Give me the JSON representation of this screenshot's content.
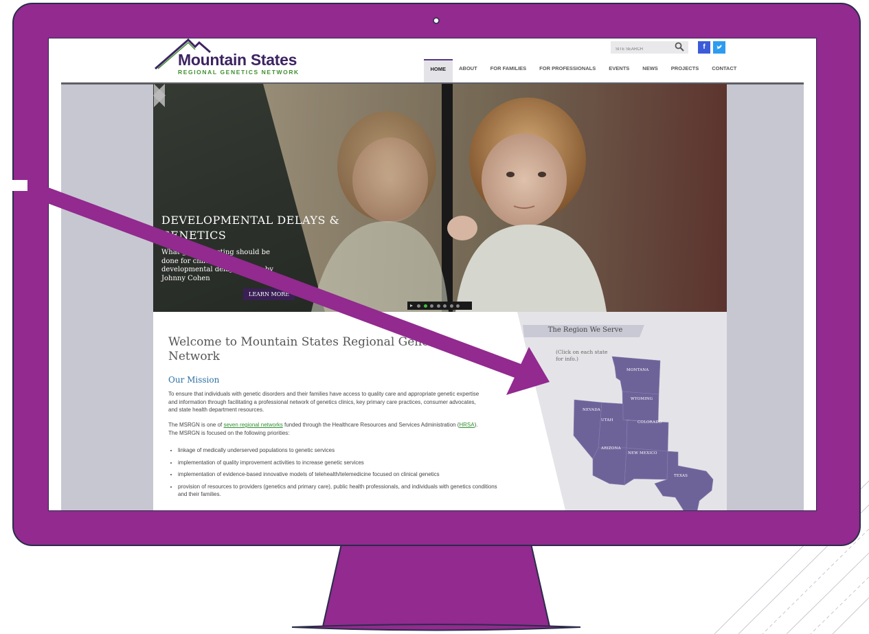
{
  "colors": {
    "monitor": "#922a8f",
    "monitor_outline": "#2b2b4a",
    "brand_purple": "#3d2462",
    "brand_green": "#3f8f2e",
    "state_fill": "#6e6399",
    "mission_blue": "#2a6fa4"
  },
  "logo": {
    "title": "Mountain States",
    "subtitle": "REGIONAL GENETICS NETWORK"
  },
  "search": {
    "placeholder": "SITE SEARCH"
  },
  "social": {
    "facebook": "f",
    "twitter": "✔"
  },
  "nav": {
    "items": [
      "HOME",
      "ABOUT",
      "FOR FAMILIES",
      "FOR PROFESSIONALS",
      "EVENTS",
      "NEWS",
      "PROJECTS",
      "CONTACT"
    ],
    "active": "HOME"
  },
  "hero": {
    "title": "DEVELOPMENTAL DELAYS & GENETICS",
    "caption": "What genetic testing should be done for children with developmental delays? Photo by Johnny Cohen",
    "button": "LEARN MORE",
    "slide_count": 8,
    "active_slide": 2
  },
  "main": {
    "welcome": "Welcome to Mountain States Regional Genetics Network",
    "mission_heading": "Our Mission",
    "mission_text": "To ensure that individuals with genetic disorders and their families have access to quality care and appropriate genetic expertise and information through facilitating a professional network of genetics clinics, key primary care practices, consumer advocates, and state health department resources.",
    "msrgn_intro": "The MSRGN is one of",
    "msrgn_link": "seven regional networks",
    "msrgn_mid": "funded through the Healthcare Resources and Services Administration (",
    "hrsa_link": "HRSA",
    "msrgn_end": "). The MSRGN is focused on the following priorities:",
    "priorities": [
      "linkage of medically underserved populations to genetic services",
      "implementation of quality improvement activities to increase genetic services",
      "implementation of evidence-based innovative models of telehealth/telemedicine focused on clinical genetics",
      "provision of resources to providers (genetics and primary care), public health professionals, and individuals with genetics conditions and their families."
    ]
  },
  "region": {
    "heading": "The Region We Serve",
    "note": "(Click on each state for info.)",
    "states": {
      "montana": "MONTANA",
      "wyoming": "WYOMING",
      "nevada": "NEVADA",
      "utah": "UTAH",
      "colorado": "COLORADO",
      "arizona": "ARIZONA",
      "new_mexico": "NEW MEXICO",
      "texas": "TEXAS"
    }
  }
}
